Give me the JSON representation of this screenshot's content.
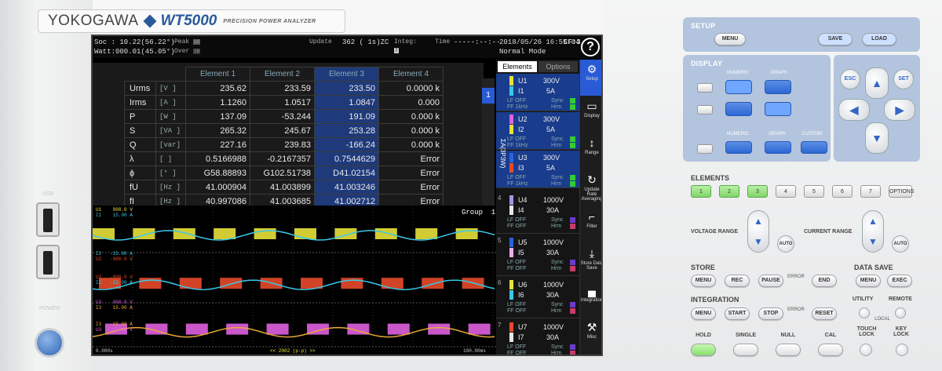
{
  "brand": {
    "maker": "YOKOGAWA",
    "model": "WT5000",
    "subtitle": "PRECISION POWER ANALYZER"
  },
  "bezel": {
    "usb_label": "USB",
    "power_label": "POWER"
  },
  "status": {
    "soc": "Soc : 10.22(56.22°)",
    "watt": "Watt:000.01(45.05°)",
    "peak": "Peak",
    "over": "Over",
    "peak_chips": [
      "1",
      "2",
      "3",
      "4",
      "5",
      "6",
      "7",
      "8",
      "9",
      "10",
      "11",
      "12",
      "13",
      "14",
      "15",
      "16"
    ],
    "over_chips": [
      "1",
      "2",
      "3",
      "4",
      "5",
      "6",
      "7",
      "8",
      "9",
      "10",
      "11",
      "12",
      "13",
      "14",
      "15",
      "16"
    ],
    "update_label": "Update",
    "update_value": "362 (   1s)ZC",
    "integ_label": "Integ:",
    "integ_chips": [
      "1",
      "2",
      "3",
      "4",
      "5",
      "6",
      "7"
    ],
    "time_label": "Time",
    "time_value": "-----:--:--",
    "datetime": "2018/05/26 16:55:04",
    "cf": "CF:3",
    "mode": "Normal Mode",
    "help": "?"
  },
  "table": {
    "headers": [
      "Element 1",
      "Element 2",
      "Element 3",
      "Element 4"
    ],
    "rows": [
      {
        "name": "Urms",
        "unit": "[V ]",
        "vals": [
          "235.62",
          "233.59",
          "233.50",
          "0.0000 k"
        ]
      },
      {
        "name": "Irms",
        "unit": "[A ]",
        "vals": [
          "1.1260",
          "1.0517",
          "1.0847",
          "0.000"
        ]
      },
      {
        "name": "P",
        "unit": "[W ]",
        "vals": [
          "137.09",
          "-53.244",
          "191.09",
          "0.000 k"
        ]
      },
      {
        "name": "S",
        "unit": "[VA ]",
        "vals": [
          "265.32",
          "245.67",
          "253.28",
          "0.000 k"
        ]
      },
      {
        "name": "Q",
        "unit": "[var]",
        "vals": [
          "227.16",
          "239.83",
          "-166.24",
          "0.000 k"
        ]
      },
      {
        "name": "λ",
        "unit": "[ ]",
        "vals": [
          "0.5166988",
          "-0.2167357",
          "0.7544629",
          "Error"
        ]
      },
      {
        "name": "ϕ",
        "unit": "[° ]",
        "vals": [
          "G58.88893",
          "G102.51738",
          "D41.02154",
          "Error"
        ]
      },
      {
        "name": "fU",
        "unit": "[Hz ]",
        "vals": [
          "41.000904",
          "41.003899",
          "41.003246",
          "Error"
        ]
      },
      {
        "name": "fI",
        "unit": "[Hz ]",
        "vals": [
          "40.997086",
          "41.003685",
          "41.002712",
          "Error"
        ]
      }
    ],
    "page": "1",
    "page_total": "9"
  },
  "wave": {
    "group_label": "Group  1",
    "bottom_left": "0.000s",
    "bottom_center": "<< 2002 (p-p) >>",
    "bottom_right": "100.00ms",
    "scales": [
      {
        "l1": "U1    900.0 V",
        "l2": "I1    15.00 A",
        "c1": "#e8e23a",
        "c2": "#3ac8e8"
      },
      {
        "l1": "I2   -15.00 A",
        "l2": "U2   -900.0 V",
        "c1": "#3ac8e8",
        "c2": "#e84a2a"
      },
      {
        "l1": "U3   -900.0 V",
        "l2": "I1   -15.00 A",
        "c1": "#e84a2a",
        "c2": "#3ac8e8"
      },
      {
        "l1": "U3    900.0 V",
        "l2": "I3    15.00 A",
        "c1": "#e060e0",
        "c2": "#e8a83a"
      },
      {
        "l1": "I3   -15.00 A",
        "l2": "U3   -900.0 V",
        "c1": "#e8a83a",
        "c2": "#e060e0"
      }
    ]
  },
  "side": {
    "tabs": [
      "Elements",
      "Options"
    ],
    "sigma": "ΣA(3P3W)",
    "elements": [
      {
        "num": "",
        "u": "U1",
        "uv": "300V",
        "i": "I1",
        "iv": "5A",
        "lf": "LF  OFF",
        "ff": "FF  1kHz",
        "sync": "Sync",
        "hrm": "Hrm",
        "ucol": "#e8e23a",
        "icol": "#3ac8e8",
        "sel": true
      },
      {
        "num": "",
        "u": "U2",
        "uv": "300V",
        "i": "I2",
        "iv": "5A",
        "lf": "LF  OFF",
        "ff": "FF  1kHz",
        "sync": "Sync",
        "hrm": "Hrm",
        "ucol": "#e060e0",
        "icol": "#e8e23a",
        "sel": true
      },
      {
        "num": "",
        "u": "U3",
        "uv": "300V",
        "i": "I3",
        "iv": "5A",
        "lf": "LF  OFF",
        "ff": "FF  1kHz",
        "sync": "Sync",
        "hrm": "Hrm",
        "ucol": "#2a62e0",
        "icol": "#e84a2a",
        "sel": true
      },
      {
        "num": "4",
        "u": "U4",
        "uv": "1000V",
        "i": "I4",
        "iv": "30A",
        "lf": "LF  OFF",
        "ff": "FF  OFF",
        "sync": "Sync",
        "hrm": "Hrm",
        "ucol": "#9a9ae8",
        "icol": "#e8e8e8",
        "sel": false
      },
      {
        "num": "5",
        "u": "U5",
        "uv": "1000V",
        "i": "I5",
        "iv": "30A",
        "lf": "LF  OFF",
        "ff": "FF  OFF",
        "sync": "Sync",
        "hrm": "Hrm",
        "ucol": "#2a62e0",
        "icol": "#e8b0e8",
        "sel": false
      },
      {
        "num": "6",
        "u": "U6",
        "uv": "1000V",
        "i": "I6",
        "iv": "30A",
        "lf": "LF  OFF",
        "ff": "FF  OFF",
        "sync": "Sync",
        "hrm": "Hrm",
        "ucol": "#e8e23a",
        "icol": "#3ac8e8",
        "sel": false
      },
      {
        "num": "7",
        "u": "U7",
        "uv": "1000V",
        "i": "I7",
        "iv": "30A",
        "lf": "LF  OFF",
        "ff": "FF  OFF",
        "sync": "Sync",
        "hrm": "Hrm",
        "ucol": "#e84a2a",
        "icol": "#e8e8e8",
        "sel": false
      }
    ]
  },
  "menu": [
    {
      "label": "Setup",
      "icon": "⚙"
    },
    {
      "label": "Display",
      "icon": "▭"
    },
    {
      "label": "Range",
      "icon": "↕"
    },
    {
      "label": "Update Rate Averaging",
      "icon": "↻"
    },
    {
      "label": "Filter",
      "icon": "⌐"
    },
    {
      "label": "Store Data Save",
      "icon": "⤓"
    },
    {
      "label": "Integration",
      "icon": "▄"
    },
    {
      "label": "Misc",
      "icon": "⚒"
    }
  ],
  "panel": {
    "setup": "SETUP",
    "menu": "MENU",
    "save": "SAVE",
    "load": "LOAD",
    "display": "DISPLAY",
    "numeric": "NUMERIC",
    "graph": "GRAPH",
    "custom": "CUSTOM",
    "esc": "ESC",
    "set": "SET",
    "elements": "ELEMENTS",
    "el_buttons": [
      "1",
      "2",
      "3",
      "4",
      "5",
      "6",
      "7",
      "OPTIONS"
    ],
    "voltage_range": "VOLTAGE RANGE",
    "current_range": "CURRENT RANGE",
    "auto": "AUTO",
    "store": "STORE",
    "store_btns": [
      "MENU",
      "REC",
      "PAUSE",
      "END"
    ],
    "error": "ERROR",
    "data_save": "DATA SAVE",
    "ds_btns": [
      "MENU",
      "EXEC"
    ],
    "integration": "INTEGRATION",
    "int_btns": [
      "MENU",
      "START",
      "STOP",
      "RESET"
    ],
    "utility": "UTILITY",
    "remote": "REMOTE",
    "local": "LOCAL",
    "bottom": [
      "HOLD",
      "SINGLE",
      "NULL",
      "CAL"
    ],
    "touch_lock": "TOUCH LOCK",
    "key_lock": "KEY LOCK"
  }
}
